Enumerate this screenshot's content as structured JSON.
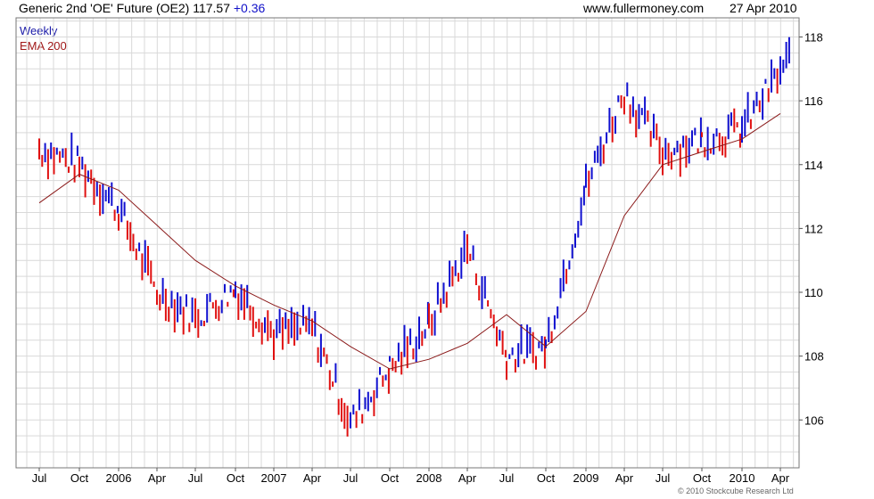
{
  "header": {
    "title": "Generic 2nd 'OE' Future (OE2)",
    "last": "117.57",
    "change": "+0.36",
    "source": "www.fullermoney.com",
    "date": "27 Apr 2010"
  },
  "copyright": "© 2010 Stockcube Research Ltd",
  "colors": {
    "up": "#1010d0",
    "down": "#e01010",
    "ema": "#8b1a1a",
    "grid": "#d9d9d9"
  },
  "chart_data": {
    "type": "bar",
    "bar_style": "weekly high-low range bars, blue = up week, red = down week",
    "ylim": [
      104.5,
      118.6
    ],
    "yticks": [
      106,
      108,
      110,
      112,
      114,
      116,
      118
    ],
    "x_ticks": [
      "Jul",
      "Oct",
      "2006",
      "Apr",
      "Jul",
      "Oct",
      "2007",
      "Apr",
      "Jul",
      "Oct",
      "2008",
      "Apr",
      "Jul",
      "Oct",
      "2009",
      "Apr",
      "Jul",
      "Oct",
      "2010",
      "Apr"
    ],
    "legend": [
      "Weekly",
      "EMA 200"
    ],
    "grid": true,
    "series": [
      {
        "name": "Weekly",
        "x": [
          "Jul",
          "Oct",
          "2006",
          "Apr",
          "Jul",
          "Oct",
          "2007",
          "Apr",
          "Jul",
          "Oct",
          "2008",
          "Apr",
          "Jul",
          "Oct",
          "2009",
          "Apr",
          "Jul",
          "Oct",
          "2010",
          "Apr"
        ],
        "values": [
          114.5,
          114.0,
          112.6,
          110.0,
          109.2,
          110.1,
          108.7,
          108.9,
          105.9,
          107.6,
          109.0,
          111.4,
          108.0,
          108.3,
          113.3,
          116.3,
          114.4,
          114.8,
          115.1,
          116.9
        ]
      },
      {
        "name": "EMA 200",
        "x": [
          "Jul",
          "Oct",
          "2006",
          "Apr",
          "Jul",
          "Oct",
          "2007",
          "Apr",
          "Jul",
          "Oct",
          "2008",
          "Apr",
          "Jul",
          "Oct",
          "2009",
          "Apr",
          "Jul",
          "Oct",
          "2010",
          "Apr"
        ],
        "values": [
          112.8,
          113.7,
          113.2,
          112.1,
          111.0,
          110.2,
          109.6,
          109.1,
          108.3,
          107.6,
          107.9,
          108.4,
          109.3,
          108.3,
          109.4,
          112.4,
          114.0,
          114.4,
          114.8,
          115.6
        ]
      }
    ]
  }
}
